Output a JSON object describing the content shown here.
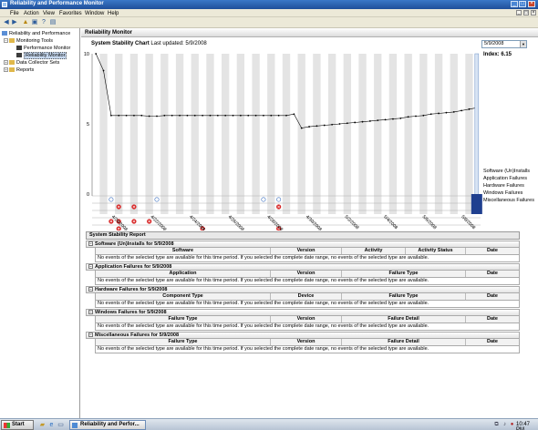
{
  "window": {
    "title": "Reliability and Performance Monitor",
    "minimize": "_",
    "maximize": "□",
    "close": "×"
  },
  "menu": [
    "File",
    "Action",
    "View",
    "Favorites",
    "Window",
    "Help"
  ],
  "mdi_controls": [
    "_",
    "□",
    "×"
  ],
  "toolbar": [
    "back-icon",
    "forward-icon",
    "up-icon",
    "properties-icon",
    "help-icon",
    "show-hide-icon"
  ],
  "tree": {
    "items": [
      {
        "label": "Reliability and Performance",
        "level": 0,
        "expander": "",
        "icon": "monitor-icon"
      },
      {
        "label": "Monitoring Tools",
        "level": 1,
        "expander": "−",
        "icon": "folder-icon"
      },
      {
        "label": "Performance Monitor",
        "level": 2,
        "expander": "",
        "icon": "chart-icon"
      },
      {
        "label": "Reliability Monitor",
        "level": 2,
        "expander": "",
        "icon": "chart-icon",
        "selected": true
      },
      {
        "label": "Data Collector Sets",
        "level": 1,
        "expander": "+",
        "icon": "folder-icon"
      },
      {
        "label": "Reports",
        "level": 1,
        "expander": "+",
        "icon": "folder-icon"
      }
    ]
  },
  "pane": {
    "header": "Reliability Monitor",
    "chart_title": "System Stability Chart",
    "last_updated": "Last updated: 5/9/2008",
    "date_selected": "5/9/2008",
    "index": "Index: 6.15"
  },
  "side_labels": [
    "Software (Un)Installs",
    "Application Failures",
    "Hardware Failures",
    "Windows Failures",
    "Miscellaneous Failures"
  ],
  "colors": {
    "stripe": "#e4e4e4",
    "line": "#000000",
    "failure": "#d72222",
    "selection": "#1f3f8f"
  },
  "chart_data": {
    "type": "line",
    "ylim": [
      0,
      10
    ],
    "yticks": [
      "10",
      "5",
      "0"
    ],
    "x": [
      "4/20/2008",
      "4/21/2008",
      "4/22/2008",
      "4/23/2008",
      "4/24/2008",
      "4/25/2008",
      "4/26/2008",
      "4/27/2008",
      "4/28/2008",
      "4/29/2008",
      "4/30/2008",
      "5/1/2008",
      "5/2/2008",
      "5/3/2008",
      "5/4/2008",
      "5/5/2008",
      "5/6/2008",
      "5/7/2008",
      "5/8/2008",
      "5/9/2008"
    ],
    "xtick_labels": [
      "4/20/2008",
      "4/22/2008",
      "4/24/2008",
      "4/26/2008",
      "4/28/2008",
      "4/30/2008",
      "5/2/2008",
      "5/4/2008",
      "5/6/2008",
      "5/8/2008"
    ],
    "values": [
      10,
      8.8,
      5.6,
      5.6,
      5.6,
      5.6,
      5.6,
      5.55,
      5.55,
      5.6,
      5.6,
      5.6,
      5.6,
      5.6,
      5.6,
      5.6,
      5.6,
      5.6,
      5.6,
      5.6,
      5.6,
      5.6,
      5.6,
      5.6,
      5.6,
      5.6,
      5.7,
      4.7,
      4.8,
      4.85,
      4.9,
      4.95,
      5.0,
      5.05,
      5.1,
      5.15,
      5.2,
      5.25,
      5.3,
      5.35,
      5.4,
      5.5,
      5.55,
      5.6,
      5.7,
      5.75,
      5.8,
      5.85,
      5.95,
      6.05,
      6.15
    ],
    "events": {
      "software_installs": [
        2,
        8,
        22,
        24
      ],
      "application_failures": [
        3,
        5,
        24
      ],
      "windows_failures": [
        2,
        3,
        5,
        7
      ],
      "miscellaneous_failures": [
        3,
        14,
        24
      ]
    }
  },
  "report": {
    "header": "System Stability Report",
    "sections": [
      {
        "title": "Software (Un)Installs for 5/9/2008",
        "columns": [
          "Software",
          "Version",
          "Activity",
          "Activity Status",
          "Date"
        ],
        "message": "No events of the selected type are available for this time period. If you selected the complete date range, no events of the selected type are available."
      },
      {
        "title": "Application Failures for 5/9/2008",
        "columns": [
          "Application",
          "Version",
          "Failure Type",
          "Date"
        ],
        "message": "No events of the selected type are available for this time period. If you selected the complete date range, no events of the selected type are available."
      },
      {
        "title": "Hardware Failures for 5/9/2008",
        "columns": [
          "Component Type",
          "Device",
          "Failure Type",
          "Date"
        ],
        "message": "No events of the selected type are available for this time period. If you selected the complete date range, no events of the selected type are available."
      },
      {
        "title": "Windows Failures for 5/9/2008",
        "columns": [
          "Failure Type",
          "Version",
          "Failure Detail",
          "Date"
        ],
        "message": "No events of the selected type are available for this time period. If you selected the complete date range, no events of the selected type are available."
      },
      {
        "title": "Miscellaneous Failures for 5/9/2008",
        "columns": [
          "Failure Type",
          "Version",
          "Failure Detail",
          "Date"
        ],
        "message": "No events of the selected type are available for this time period. If you selected the complete date range, no events of the selected type are available."
      }
    ]
  },
  "taskbar": {
    "start": "Start",
    "quicklaunch": [
      "explorer-icon",
      "ie-icon",
      "show-desktop-icon"
    ],
    "task": "Reliability and Perfor...",
    "tray": [
      "network-icon",
      "volume-icon",
      "security-icon"
    ],
    "clock": "10:47 PM"
  }
}
